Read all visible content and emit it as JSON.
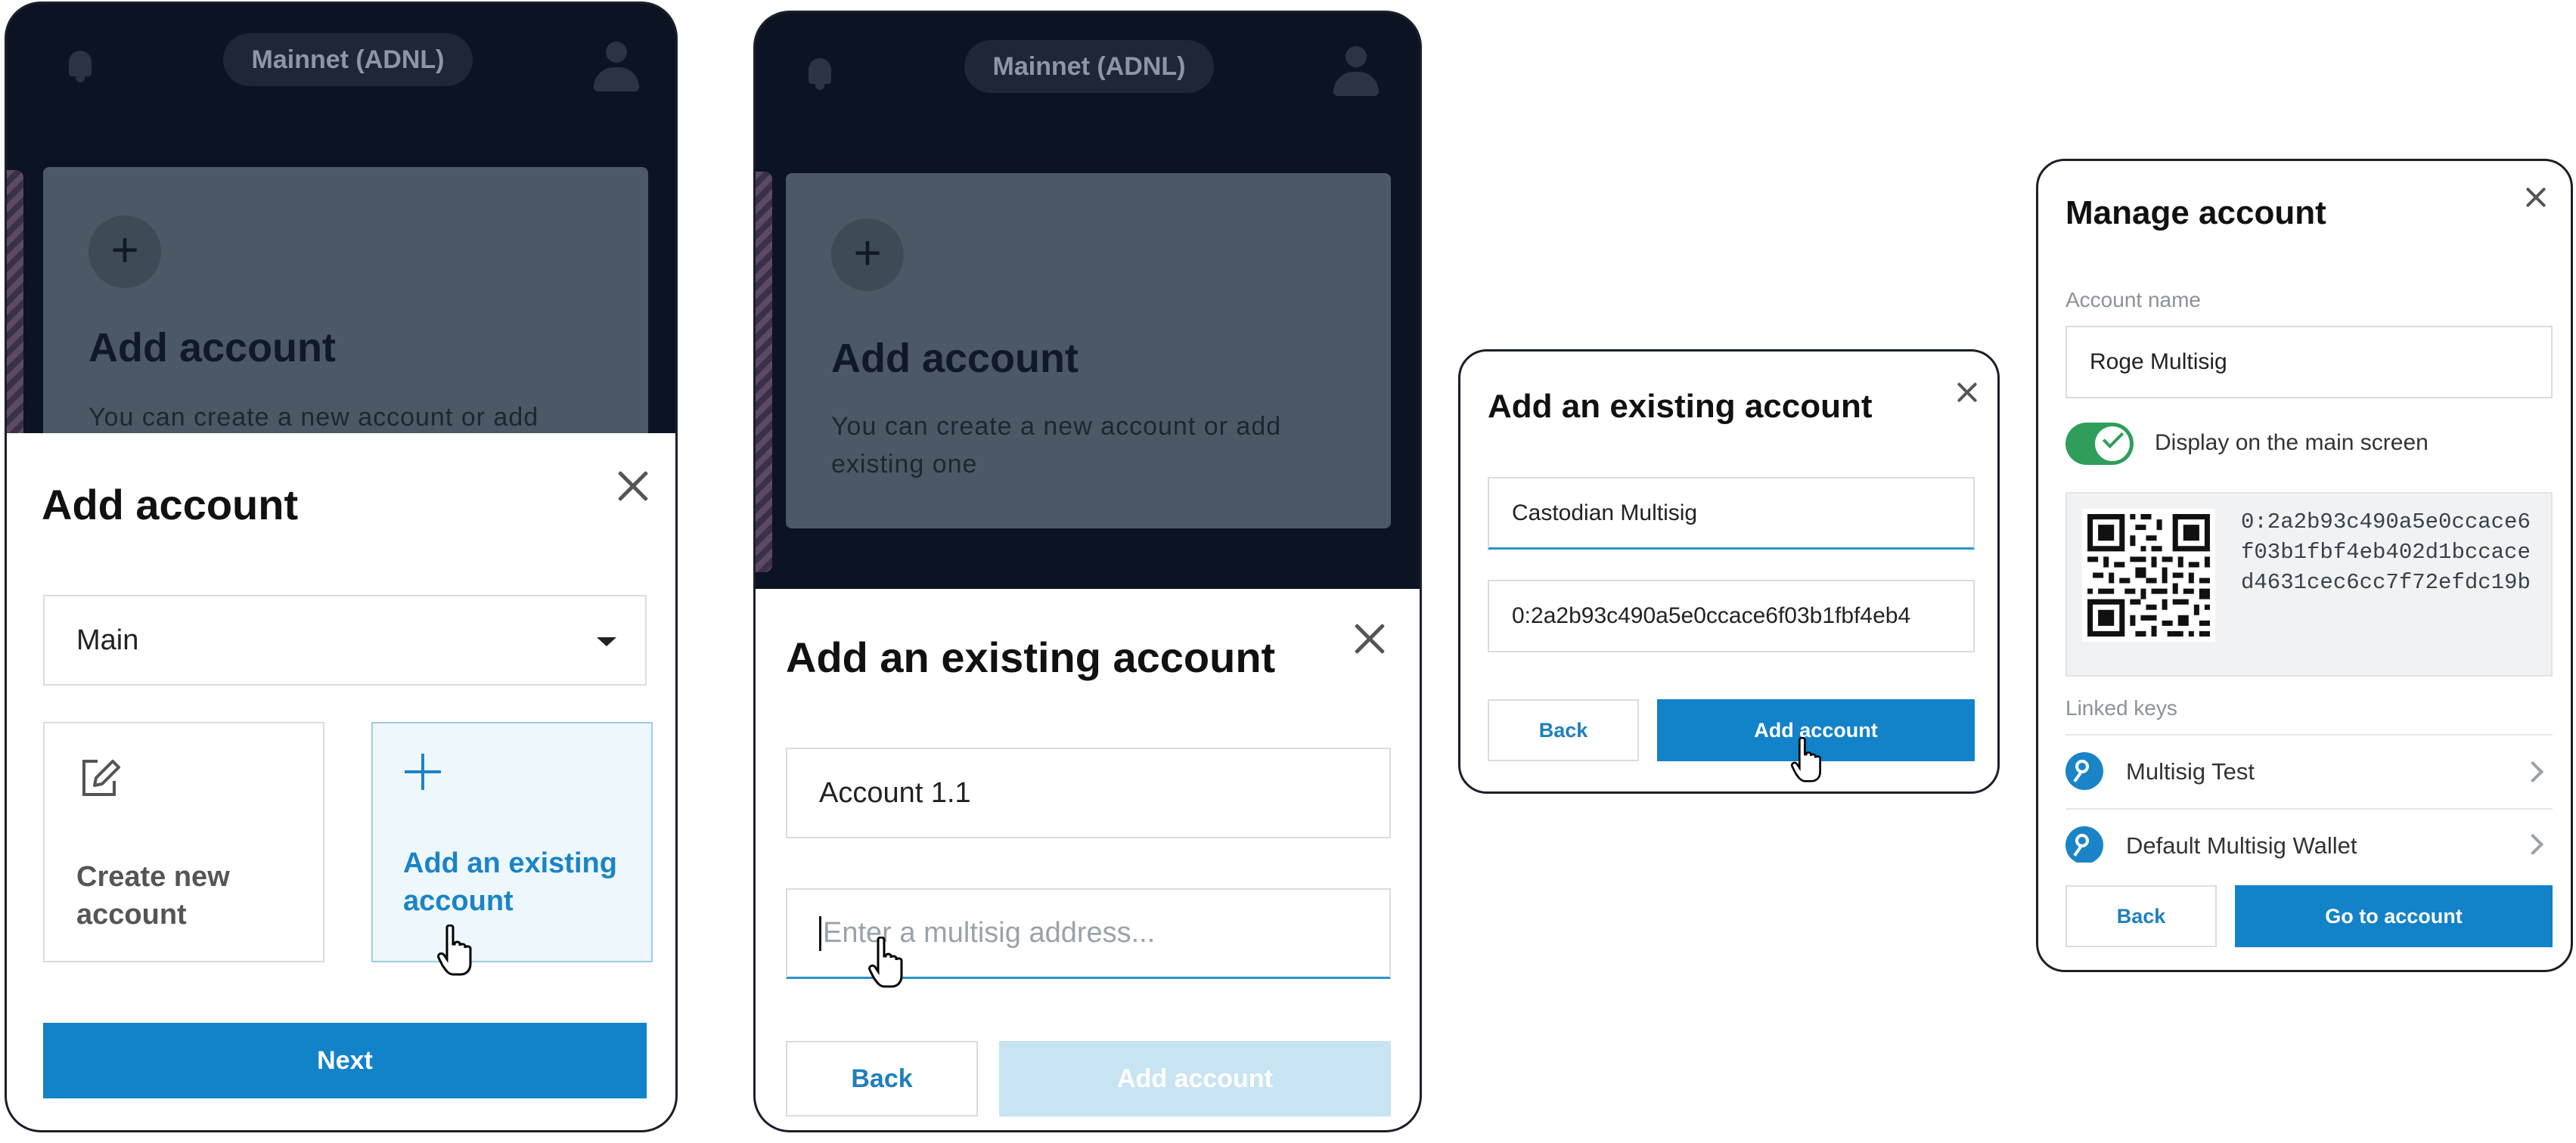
{
  "panel1": {
    "network": "Mainnet (ADNL)",
    "card": {
      "title": "Add account",
      "description": "You can create a new account or add"
    },
    "sheet": {
      "title": "Add account",
      "select_value": "Main",
      "option_create": "Create new account",
      "option_existing": "Add an existing account",
      "next_label": "Next"
    }
  },
  "panel2": {
    "network": "Mainnet (ADNL)",
    "card": {
      "title": "Add account",
      "description": "You can create a new account or add existing one"
    },
    "sheet": {
      "title": "Add an existing account",
      "name_value": "Account 1.1",
      "address_placeholder": "Enter a multisig address...",
      "back_label": "Back",
      "add_label": "Add account"
    }
  },
  "panel3": {
    "title": "Add an existing account",
    "name_value": "Castodian Multisig",
    "address_value": "0:2a2b93c490a5e0ccace6f03b1fbf4eb4",
    "back_label": "Back",
    "add_label": "Add account"
  },
  "panel4": {
    "title": "Manage account",
    "name_label": "Account name",
    "name_value": "Roge Multisig",
    "display_label": "Display on the main screen",
    "display_enabled": true,
    "address": "0:2a2b93c490a5e0ccace6f03b1fbf4eb402d1bccaced4631cec6cc7f72efdc19b",
    "linked_keys_label": "Linked keys",
    "keys": [
      {
        "label": "Multisig Test"
      },
      {
        "label": "Default Multisig Wallet"
      }
    ],
    "back_label": "Back",
    "go_label": "Go to account"
  },
  "colors": {
    "primary": "#1282c9",
    "primary_disabled": "#c8e4f2",
    "dark_bg": "#0c1323",
    "toggle_on": "#2e9e5a"
  }
}
